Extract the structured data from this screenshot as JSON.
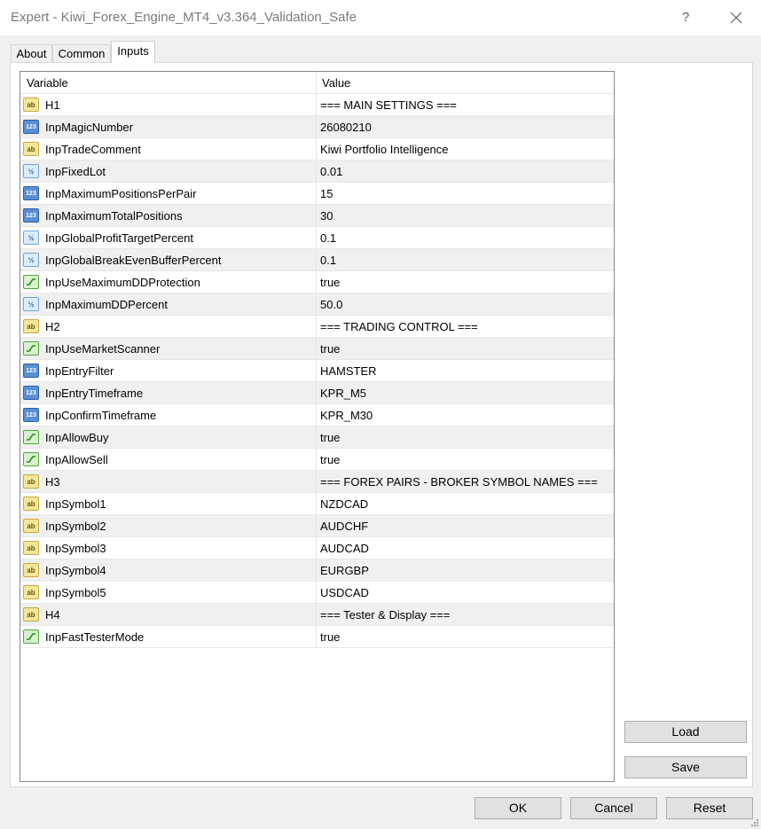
{
  "window": {
    "title": "Expert - Kiwi_Forex_Engine_MT4_v3.364_Validation_Safe",
    "help_label": "?"
  },
  "tabs": [
    {
      "label": "About"
    },
    {
      "label": "Common"
    },
    {
      "label": "Inputs",
      "active": true
    }
  ],
  "grid": {
    "col_variable": "Variable",
    "col_value": "Value",
    "rows": [
      {
        "icon": "ab",
        "icon_text": "ab",
        "name": "H1",
        "value": "=== MAIN SETTINGS ==="
      },
      {
        "icon": "num",
        "icon_text": "123",
        "name": "InpMagicNumber",
        "value": "26080210"
      },
      {
        "icon": "ab",
        "icon_text": "ab",
        "name": "InpTradeComment",
        "value": "Kiwi Portfolio Intelligence"
      },
      {
        "icon": "half",
        "icon_text": "½",
        "name": "InpFixedLot",
        "value": "0.01"
      },
      {
        "icon": "num",
        "icon_text": "123",
        "name": "InpMaximumPositionsPerPair",
        "value": "15"
      },
      {
        "icon": "num",
        "icon_text": "123",
        "name": "InpMaximumTotalPositions",
        "value": "30"
      },
      {
        "icon": "half",
        "icon_text": "½",
        "name": "InpGlobalProfitTargetPercent",
        "value": "0.1"
      },
      {
        "icon": "half",
        "icon_text": "½",
        "name": "InpGlobalBreakEvenBufferPercent",
        "value": "0.1"
      },
      {
        "icon": "bool",
        "icon_text": "",
        "name": "InpUseMaximumDDProtection",
        "value": "true"
      },
      {
        "icon": "half",
        "icon_text": "½",
        "name": "InpMaximumDDPercent",
        "value": "50.0"
      },
      {
        "icon": "ab",
        "icon_text": "ab",
        "name": "H2",
        "value": "=== TRADING CONTROL ==="
      },
      {
        "icon": "bool",
        "icon_text": "",
        "name": "InpUseMarketScanner",
        "value": "true"
      },
      {
        "icon": "num",
        "icon_text": "123",
        "name": "InpEntryFilter",
        "value": "HAMSTER"
      },
      {
        "icon": "num",
        "icon_text": "123",
        "name": "InpEntryTimeframe",
        "value": "KPR_M5"
      },
      {
        "icon": "num",
        "icon_text": "123",
        "name": "InpConfirmTimeframe",
        "value": "KPR_M30"
      },
      {
        "icon": "bool",
        "icon_text": "",
        "name": "InpAllowBuy",
        "value": "true"
      },
      {
        "icon": "bool",
        "icon_text": "",
        "name": "InpAllowSell",
        "value": "true"
      },
      {
        "icon": "ab",
        "icon_text": "ab",
        "name": "H3",
        "value": "=== FOREX PAIRS - BROKER SYMBOL NAMES ==="
      },
      {
        "icon": "ab",
        "icon_text": "ab",
        "name": "InpSymbol1",
        "value": "NZDCAD"
      },
      {
        "icon": "ab",
        "icon_text": "ab",
        "name": "InpSymbol2",
        "value": "AUDCHF"
      },
      {
        "icon": "ab",
        "icon_text": "ab",
        "name": "InpSymbol3",
        "value": "AUDCAD"
      },
      {
        "icon": "ab",
        "icon_text": "ab",
        "name": "InpSymbol4",
        "value": "EURGBP"
      },
      {
        "icon": "ab",
        "icon_text": "ab",
        "name": "InpSymbol5",
        "value": "USDCAD"
      },
      {
        "icon": "ab",
        "icon_text": "ab",
        "name": "H4",
        "value": "=== Tester & Display ==="
      },
      {
        "icon": "bool",
        "icon_text": "",
        "name": "InpFastTesterMode",
        "value": "true"
      }
    ]
  },
  "buttons": {
    "load": "Load",
    "save": "Save",
    "ok": "OK",
    "cancel": "Cancel",
    "reset": "Reset"
  },
  "icons": {
    "string": "ab-string-icon",
    "integer": "integer-123-icon",
    "double": "double-half-icon",
    "boolean": "boolean-toggle-icon",
    "close": "close-icon"
  },
  "colors": {
    "row_alt": "#f0f0f0",
    "grid_border": "#828790",
    "button_bg": "#e1e1e1"
  }
}
